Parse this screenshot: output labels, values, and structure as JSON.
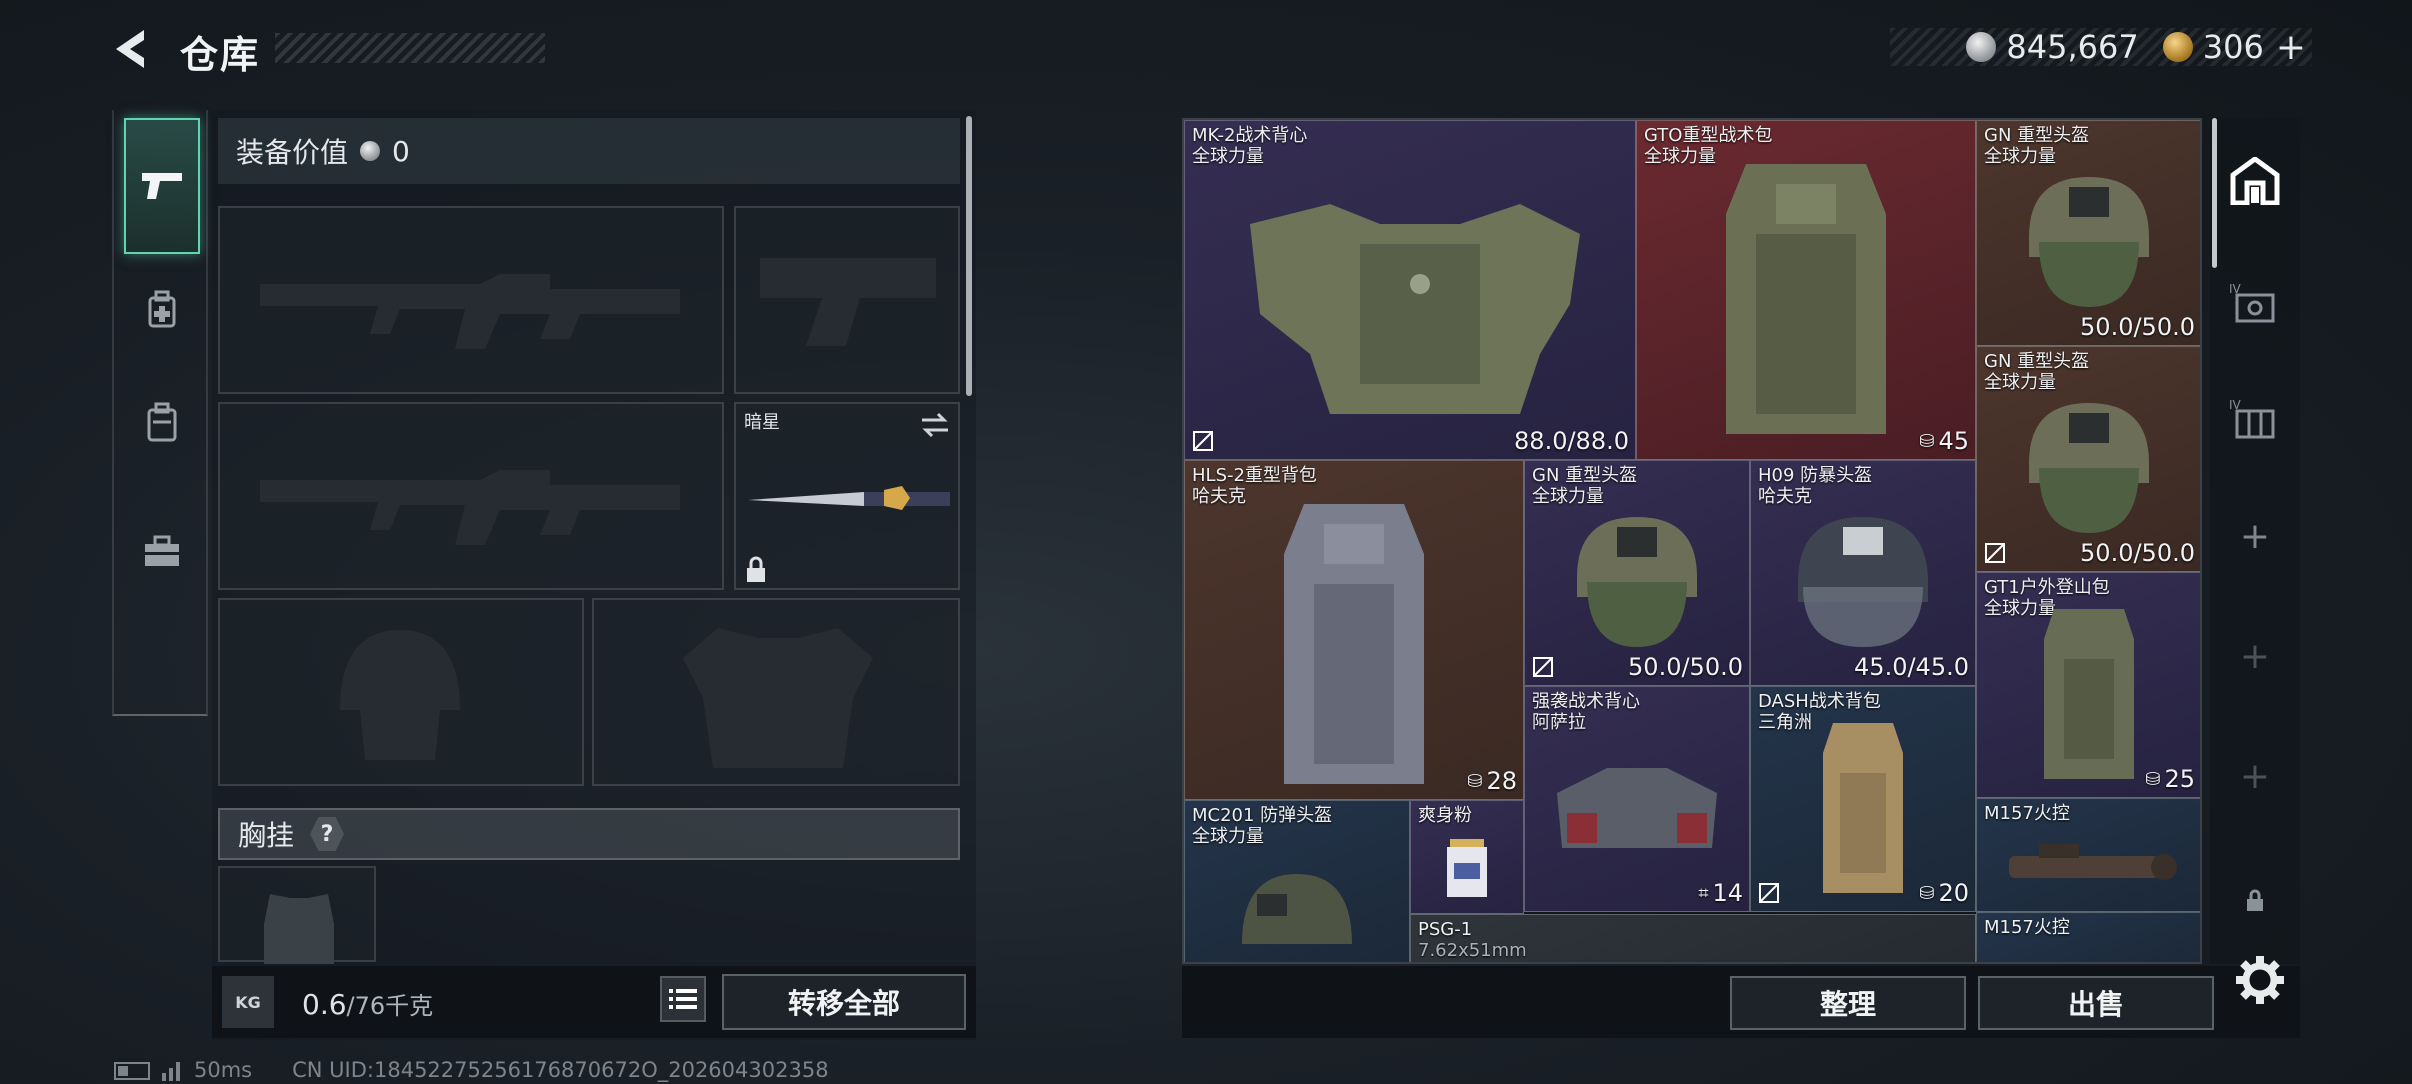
{
  "header": {
    "title": "仓库",
    "silver_amount": "845,667",
    "gold_amount": "306",
    "add_label": "+"
  },
  "rail": {
    "items": [
      "pistol-icon",
      "medkit-icon",
      "backpack-icon",
      "toolbox-icon"
    ]
  },
  "loadout": {
    "value_label": "装备价值",
    "value_amount": "0",
    "melee_name": "暗星",
    "chest_label": "胸挂",
    "chest_help": "?",
    "weight_value": "0.6",
    "weight_max": "/76千克",
    "weight_icon_text": "KG",
    "transfer_all": "转移全部"
  },
  "stash": {
    "items": [
      {
        "name": "MK-2战术背心",
        "sub": "全球力量",
        "durability": "88.0/88.0"
      },
      {
        "name": "GTO重型战术包",
        "sub": "全球力量",
        "capacity": "45"
      },
      {
        "name": "GN 重型头盔",
        "sub": "全球力量",
        "durability": "50.0/50.0"
      },
      {
        "name": "GN 重型头盔",
        "sub": "全球力量",
        "durability": "50.0/50.0"
      },
      {
        "name": "HLS-2重型背包",
        "sub": "哈夫克",
        "capacity": "28"
      },
      {
        "name": "GN 重型头盔",
        "sub": "全球力量",
        "durability": "50.0/50.0"
      },
      {
        "name": "H09 防暴头盔",
        "sub": "哈夫克",
        "durability": "45.0/45.0"
      },
      {
        "name": "GT1户外登山包",
        "sub": "全球力量",
        "capacity": "25"
      },
      {
        "name": "强袭战术背心",
        "sub": "阿萨拉",
        "capacity": "14"
      },
      {
        "name": "DASH战术背包",
        "sub": "三角洲",
        "capacity": "20"
      },
      {
        "name": "MC201 防弹头盔",
        "sub": "全球力量"
      },
      {
        "name": "爽身粉",
        "sub": ""
      },
      {
        "name": "M157火控",
        "sub": ""
      },
      {
        "name": "PSG-1",
        "sub": "7.62x51mm"
      },
      {
        "name": "M157火控",
        "sub": ""
      }
    ]
  },
  "side_icons": [
    "building-icon",
    "iv-case-icon",
    "iv-container-icon",
    "plus-icon",
    "plus-icon",
    "plus-icon",
    "lock-icon"
  ],
  "actions": {
    "sort": "整理",
    "sell": "出售"
  },
  "status": {
    "ping": "50ms",
    "uid": "CN UID:18452275256176870672O_202604302358"
  },
  "colors": {
    "accent": "#5fd6b0",
    "red_cell": "#6a2a30",
    "purple_cell": "#352e52",
    "brown_cell": "#4d362d",
    "blue_cell": "#24344a"
  }
}
